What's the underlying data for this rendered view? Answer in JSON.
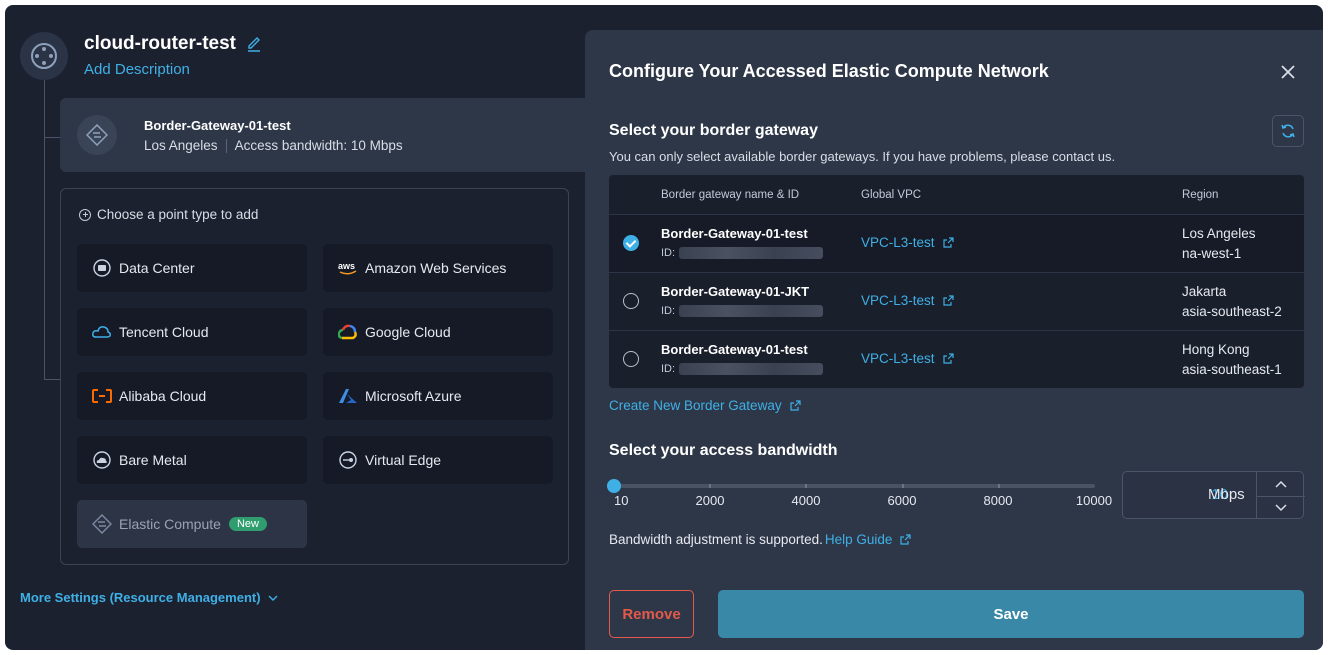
{
  "router": {
    "title": "cloud-router-test",
    "add_description": "Add Description"
  },
  "current_gateway": {
    "name": "Border-Gateway-01-test",
    "location": "Los Angeles",
    "bandwidth": "Access bandwidth: 10 Mbps"
  },
  "point_types": {
    "title": "Choose a point type to add",
    "items": [
      {
        "label": "Data Center"
      },
      {
        "label": "Amazon Web Services"
      },
      {
        "label": "Tencent Cloud"
      },
      {
        "label": "Google Cloud"
      },
      {
        "label": "Alibaba Cloud"
      },
      {
        "label": "Microsoft Azure"
      },
      {
        "label": "Bare Metal"
      },
      {
        "label": "Virtual Edge"
      },
      {
        "label": "Elastic Compute",
        "badge": "New"
      }
    ]
  },
  "more_settings": "More Settings (Resource Management)",
  "panel": {
    "title": "Configure Your Accessed Elastic Compute Network",
    "gateway_section": {
      "title": "Select your border gateway",
      "subtitle": "You can only select available border gateways. If you have problems, please contact us.",
      "columns": [
        "Border gateway name & ID",
        "Global VPC",
        "Region"
      ],
      "id_label": "ID:",
      "rows": [
        {
          "name": "Border-Gateway-01-test",
          "vpc": "VPC-L3-test",
          "region_city": "Los Angeles",
          "region_code": "na-west-1",
          "selected": true
        },
        {
          "name": "Border-Gateway-01-JKT",
          "vpc": "VPC-L3-test",
          "region_city": "Jakarta",
          "region_code": "asia-southeast-2",
          "selected": false
        },
        {
          "name": "Border-Gateway-01-test",
          "vpc": "VPC-L3-test",
          "region_city": "Hong Kong",
          "region_code": "asia-southeast-1",
          "selected": false
        }
      ],
      "create_link": "Create New Border Gateway"
    },
    "bandwidth_section": {
      "title": "Select your access bandwidth",
      "min": 10,
      "max": 10000,
      "value": 10,
      "ticks": [
        "10",
        "2000",
        "4000",
        "6000",
        "8000",
        "10000"
      ],
      "unit": "Mbps",
      "input_value": "10",
      "note": "Bandwidth adjustment is supported.",
      "help_link": "Help Guide"
    },
    "remove_label": "Remove",
    "save_label": "Save"
  },
  "colors": {
    "accent": "#3fb0e6",
    "danger": "#e35a4b",
    "save": "#3a88a8",
    "badge": "#2f9d6e"
  }
}
